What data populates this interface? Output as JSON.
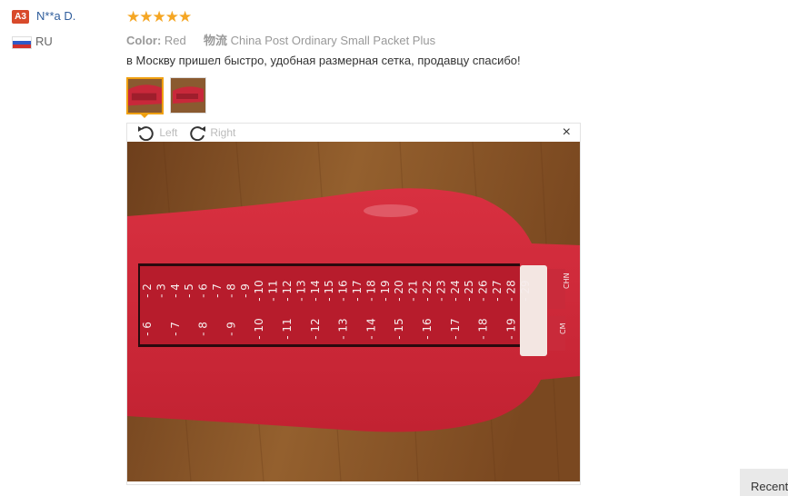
{
  "reviewer": {
    "badge": "A3",
    "name": "N**a D.",
    "country_code": "RU"
  },
  "review": {
    "stars": "★★★★★",
    "rating": 5,
    "color_label": "Color:",
    "color_value": "Red",
    "shipping_label": "物流",
    "shipping_value": "China Post Ordinary Small Packet Plus",
    "text": "в Москву пришел быстро, удобная размерная сетка, продавцу спасибо!"
  },
  "viewer": {
    "rotate_left_label": "Left",
    "rotate_right_label": "Right",
    "close_label": "×"
  },
  "ruler": {
    "top_scale": [
      "2",
      "3",
      "4",
      "5",
      "6",
      "7",
      "8",
      "9",
      "10",
      "11",
      "12",
      "13",
      "14",
      "15",
      "16",
      "17",
      "18",
      "19",
      "20",
      "21",
      "22",
      "23",
      "24",
      "25",
      "26",
      "27",
      "28",
      "29"
    ],
    "bottom_scale": [
      "6",
      "7",
      "8",
      "9",
      "10",
      "11",
      "12",
      "13",
      "14",
      "15",
      "16",
      "17",
      "18",
      "19"
    ],
    "slider_top": "CHN",
    "slider_bottom": "CM"
  },
  "recent_tab": "Recent"
}
